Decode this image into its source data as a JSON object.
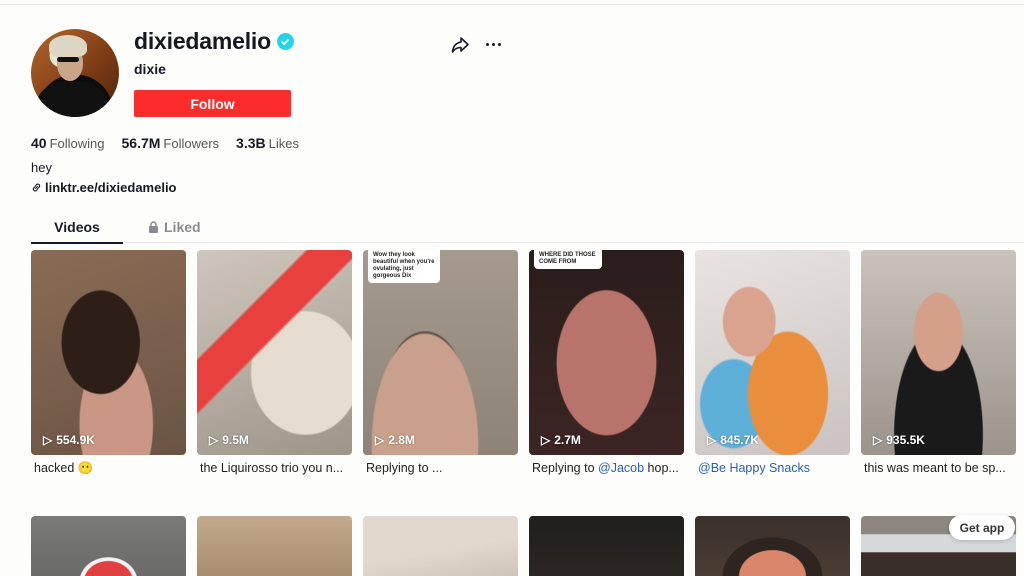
{
  "profile": {
    "username": "dixiedamelio",
    "nickname": "dixie",
    "follow_label": "Follow",
    "verified_color": "#20d5ec",
    "stats": [
      {
        "value": "40",
        "label": "Following"
      },
      {
        "value": "56.7M",
        "label": "Followers"
      },
      {
        "value": "3.3B",
        "label": "Likes"
      }
    ],
    "bio": "hey",
    "link": "linktr.ee/dixiedamelio"
  },
  "tabs": [
    {
      "label": "Videos",
      "active": true
    },
    {
      "label": "Liked",
      "locked": true
    }
  ],
  "videos": [
    {
      "views": "554.9K",
      "caption": "hacked 😶",
      "mention": ""
    },
    {
      "views": "9.5M",
      "caption": "the Liquirosso trio you n...",
      "mention": ""
    },
    {
      "views": "2.8M",
      "caption": "Replying to ...",
      "mention": "",
      "overlay": "Wow they look beautiful when you're ovulating, just gorgeous Dix"
    },
    {
      "views": "2.7M",
      "caption": "Replying to ",
      "mention": "@Jacob",
      "caption_after": " hop...",
      "overlay": "WHERE DID THOSE COME FROM"
    },
    {
      "views": "845.7K",
      "caption": "",
      "mention": "@Be Happy Snacks"
    },
    {
      "views": "935.5K",
      "caption": "this was meant to be sp...",
      "mention": ""
    }
  ],
  "get_app_label": "Get app",
  "accent_color": "#fe2c55"
}
